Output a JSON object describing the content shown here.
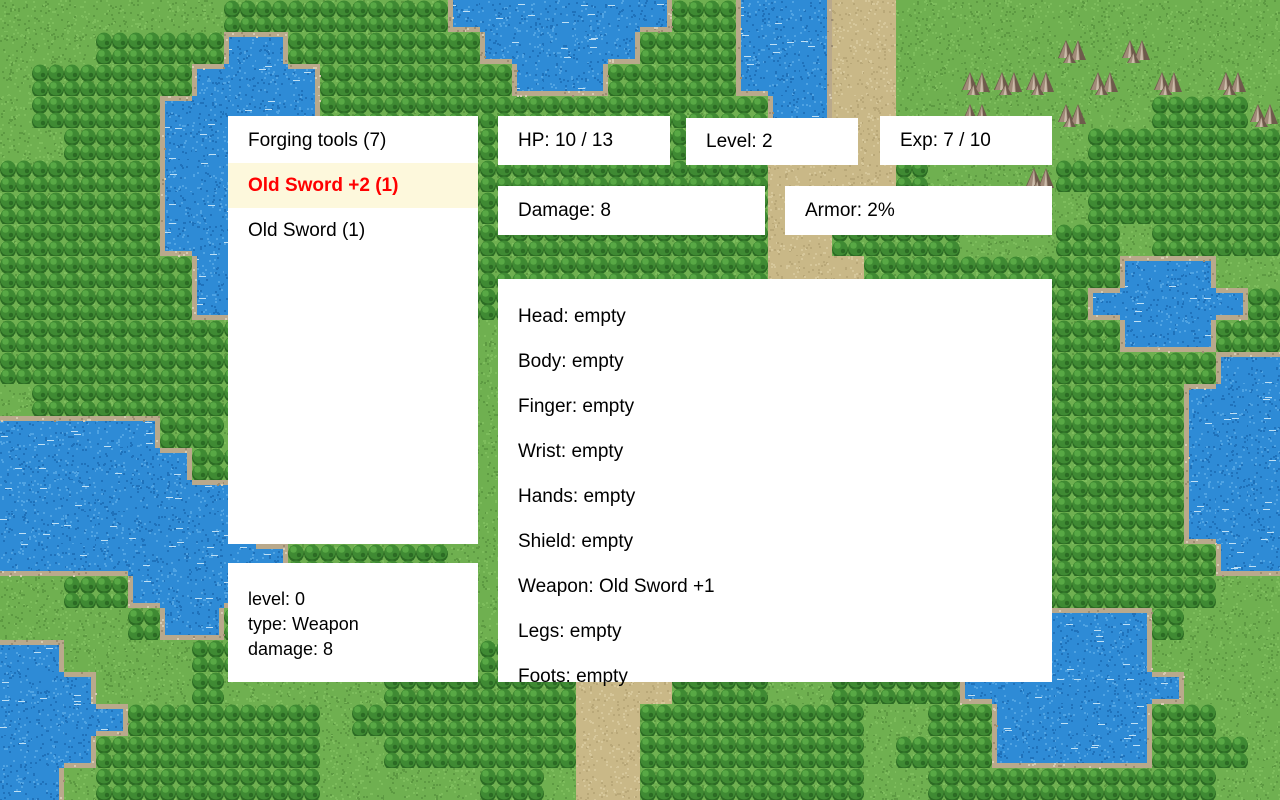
{
  "map": {
    "terrain_colors": {
      "grass": "#6fb050",
      "grass_dark": "#5d9a42",
      "forest": "#3f8a33",
      "forest_dark": "#2c6b24",
      "forest_light": "#58a845",
      "water": "#2e8bd6",
      "water_dark": "#1f72bb",
      "shore": "#b9a98c",
      "road": "#c9b887",
      "mountain": "#a08a78",
      "mountain_dark": "#6e5b4c",
      "mountain_light": "#cbbcaa"
    }
  },
  "inventory": {
    "items": [
      {
        "label": "Forging tools (7)",
        "selected": false
      },
      {
        "label": "Old Sword +2 (1)",
        "selected": true
      },
      {
        "label": "Old Sword (1)",
        "selected": false
      }
    ],
    "selected_color": "#ff0000",
    "selected_bg": "#fdf8dc"
  },
  "item_detail": {
    "lines": [
      "level: 0",
      "type: Weapon",
      "damage: 8"
    ]
  },
  "stats": {
    "hp": "HP: 10 / 13",
    "level": "Level: 2",
    "exp": "Exp: 7 / 10",
    "damage": "Damage: 8",
    "armor": "Armor: 2%"
  },
  "equipment": {
    "slots": [
      "Head: empty",
      "Body: empty",
      "Finger: empty",
      "Wrist: empty",
      "Hands: empty",
      "Shield: empty",
      "Weapon: Old Sword +1",
      "Legs: empty",
      "Foots: empty"
    ]
  }
}
